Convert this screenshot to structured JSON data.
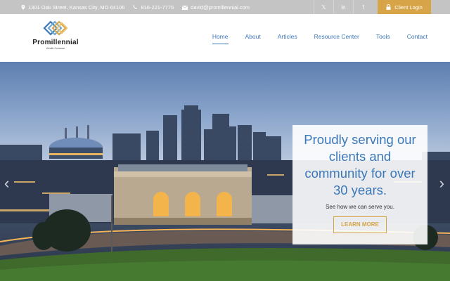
{
  "topbar": {
    "address": "1301 Oak Street, Kansas City, MO 64106",
    "phone": "816-221-7775",
    "email": "david@promillennial.com",
    "social": [
      "twitter-x-icon",
      "linkedin-icon",
      "facebook-icon"
    ],
    "social_glyphs": [
      "𝕏",
      "in",
      "f"
    ],
    "login_label": "Client Login"
  },
  "brand": {
    "name": "Promillennial",
    "tagline": "Wealth Guidance"
  },
  "nav": {
    "items": [
      "Home",
      "About",
      "Articles",
      "Resource Center",
      "Tools",
      "Contact"
    ],
    "active": "Home"
  },
  "hero": {
    "headline": "Proudly serving our clients and community for over 30 years.",
    "subtext": "See how we can serve you.",
    "button_label": "LEARN MORE",
    "prev_glyph": "‹",
    "next_glyph": "›"
  },
  "colors": {
    "accent_gold": "#d7a547",
    "link_blue": "#3b78b8",
    "topbar_gray": "#c4c4c4"
  }
}
